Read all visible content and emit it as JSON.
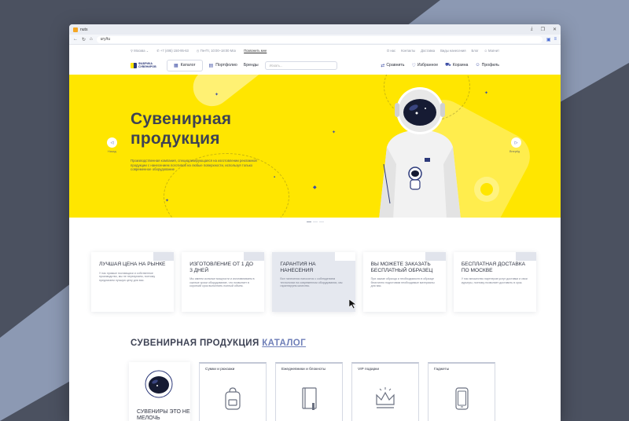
{
  "browser": {
    "tab_title": "nuts",
    "url": "ury/tu"
  },
  "topbar": {
    "city": "Москва",
    "phone": "+7 (495) 150-95-63",
    "hours": "Пн-Пт, 10:00–18:00 Мск",
    "callback": "Позвонить мне",
    "links": [
      "О нас",
      "Контакты",
      "Доставка",
      "Виды нанесения",
      "Блог"
    ],
    "account": "Магнит"
  },
  "header": {
    "logo_line1": "ФАБРИКА",
    "logo_line2": "СУВЕНИРОВ",
    "catalog": "Каталог",
    "portfolio": "Портфолио",
    "brands": "Бренды",
    "search_placeholder": "Искать...",
    "compare": "Сравнить",
    "favorites": "Избранное",
    "cart": "Корзина",
    "profile": "Профиль"
  },
  "hero": {
    "title_line1": "Сувенирная",
    "title_line2": "продукция",
    "text": "Производственная компания, специализирующаяся на изготовлении рекламной продукции с нанесением логотипов на любые поверхности, используя только современное оборудование",
    "prev": "Назад",
    "next": "Вперёд"
  },
  "features": [
    {
      "title": "ЛУЧШАЯ ЦЕНА НА РЫНКЕ",
      "text": "У нас прямые поставщики и собственное производство, мы не перекупаем, поэтому предлагаем лучшую цену для вас."
    },
    {
      "title": "ИЗГОТОВЛЕНИЕ ОТ 1 ДО 3 ДНЕЙ",
      "text": "Мы имеем сильные мощности и изготавливаем в сжатые сроки оборудование, что позволяет в короткий срок выполнить полный объем."
    },
    {
      "title": "ГАРАНТИЯ НА НАНЕСЕНИЯ",
      "text": "Все нанесения наносятся с соблюдением технологии на современном оборудовании, мы гарантируем качество."
    },
    {
      "title": "ВЫ МОЖЕТЕ ЗАКАЗАТЬ БЕСПЛАТНЫЙ ОБРАЗЕЦ",
      "text": "При заказе образца и необходимости в образце бесплатно подготовим необходимые материалы для вас."
    },
    {
      "title": "БЕСПЛАТНАЯ ДОСТАВКА ПО МОСКВЕ",
      "text": "У нас множество партнеров услуг доставки и свои курьеры, поэтому позволяет доставить в срок."
    }
  ],
  "section": {
    "title": "СУВЕНИРНАЯ ПРОДУКЦИЯ",
    "link": "КАТАЛОГ"
  },
  "categories": {
    "promo": "СУВЕНИРЫ ЭТО НЕ МЕЛОЧЬ",
    "items": [
      "Сумки и рюкзаки",
      "Ежедневники и блокноты",
      "VIP подарки",
      "Гаджеты"
    ]
  },
  "colors": {
    "hero_yellow": "#ffe600",
    "accent_blue": "#3d4ea5",
    "text_dark": "#3d4254"
  }
}
